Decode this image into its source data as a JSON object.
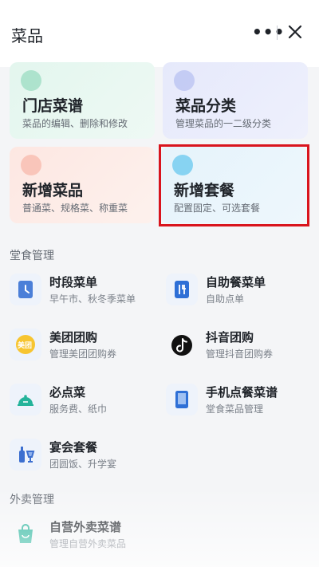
{
  "header": {
    "title": "菜品",
    "more_glyph": "•••"
  },
  "cards": [
    {
      "title": "门店菜谱",
      "subtitle": "菜品的编辑、删除和修改"
    },
    {
      "title": "菜品分类",
      "subtitle": "管理菜品的一二级分类"
    },
    {
      "title": "新增菜品",
      "subtitle": "普通菜、规格菜、称重菜"
    },
    {
      "title": "新增套餐",
      "subtitle": "配置固定、可选套餐"
    }
  ],
  "sections": {
    "dine_in": "堂食管理",
    "takeout": "外卖管理"
  },
  "dine_in_items": [
    {
      "title": "时段菜单",
      "subtitle": "早午市、秋冬季菜单",
      "icon": "clock-icon"
    },
    {
      "title": "自助餐菜单",
      "subtitle": "自助点单",
      "icon": "buffet-icon"
    },
    {
      "title": "美团团购",
      "subtitle": "管理美团团购券",
      "icon": "meituan-icon",
      "badge": "美团"
    },
    {
      "title": "抖音团购",
      "subtitle": "管理抖音团购券",
      "icon": "tiktok-icon"
    },
    {
      "title": "必点菜",
      "subtitle": "服务费、纸巾",
      "icon": "cloche-icon"
    },
    {
      "title": "手机点餐菜谱",
      "subtitle": "堂食菜品管理",
      "icon": "tablet-icon"
    },
    {
      "title": "宴会套餐",
      "subtitle": "团圆饭、升学宴",
      "icon": "banquet-icon"
    }
  ],
  "takeout_items": [
    {
      "title": "自营外卖菜谱",
      "subtitle": "管理自营外卖菜品",
      "icon": "takeout-bag-icon"
    }
  ],
  "colors": {
    "highlight": "#d9141d",
    "tiktok": "#111111",
    "meituan": "#f7c531",
    "accent_blue": "#2e6fd6"
  }
}
